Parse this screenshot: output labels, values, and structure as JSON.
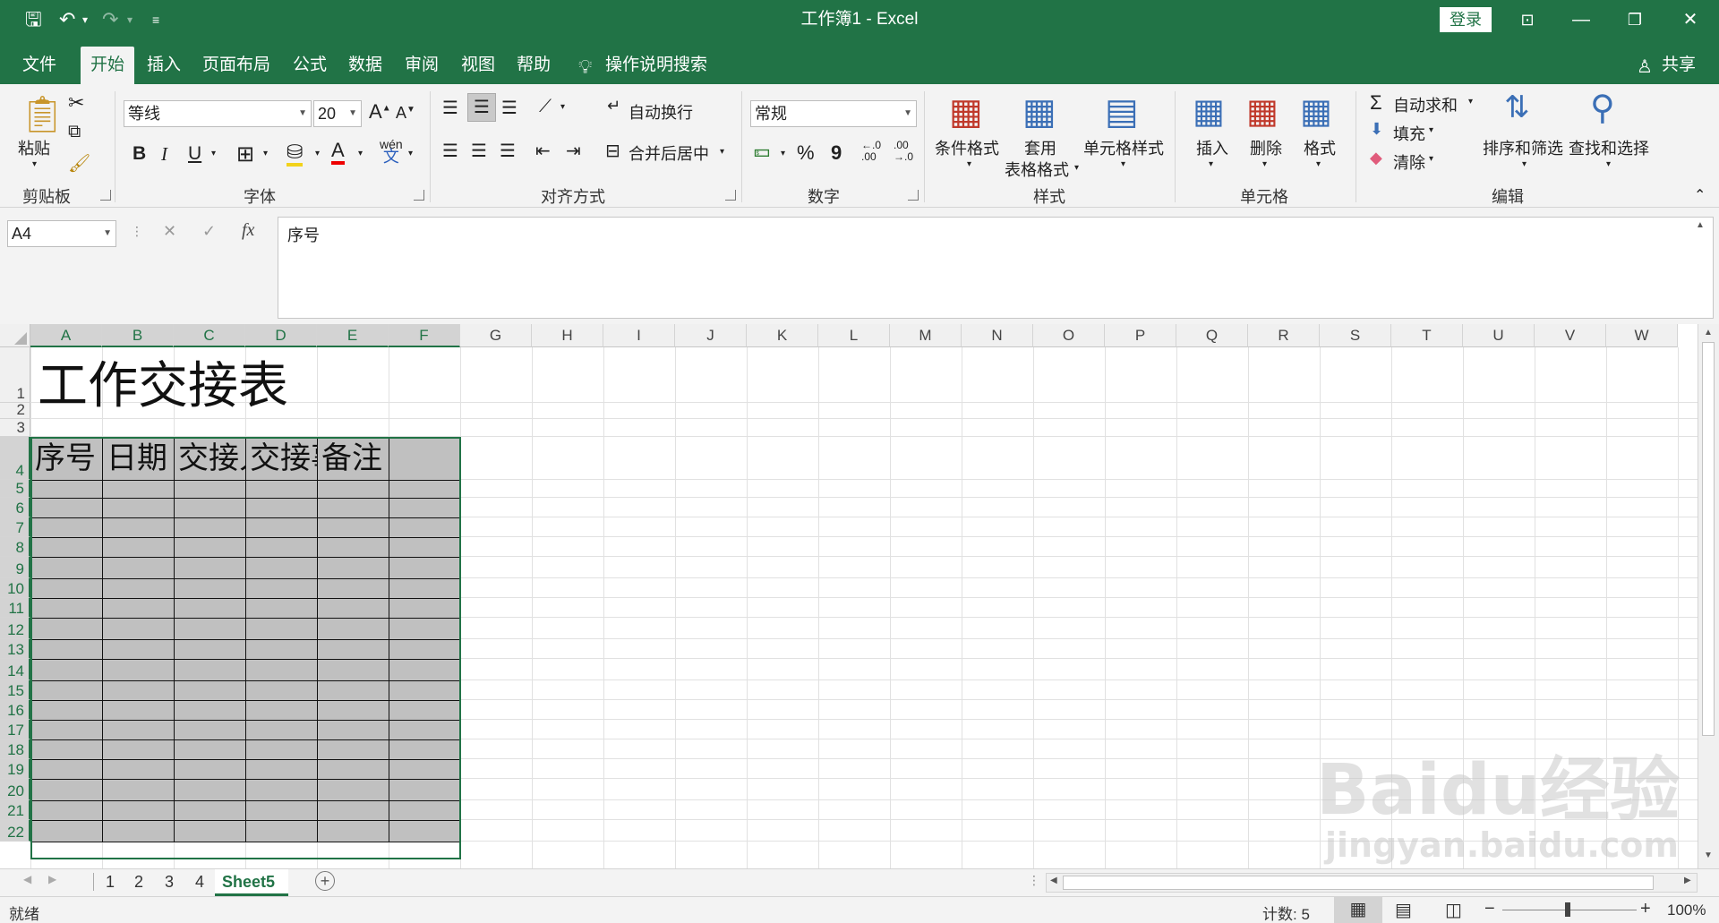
{
  "window": {
    "title": "工作簿1 - Excel",
    "login_label": "登录",
    "share_label": "共享"
  },
  "menu_tabs": [
    "文件",
    "开始",
    "插入",
    "页面布局",
    "公式",
    "数据",
    "审阅",
    "视图",
    "帮助"
  ],
  "tell_me": "操作说明搜索",
  "ribbon": {
    "clipboard": {
      "paste": "粘贴",
      "group": "剪贴板"
    },
    "font": {
      "name": "等线",
      "size": "20",
      "bold": "B",
      "italic": "I",
      "underline": "U",
      "group": "字体"
    },
    "alignment": {
      "wrap": "自动换行",
      "merge": "合并后居中",
      "group": "对齐方式"
    },
    "number": {
      "format": "常规",
      "percent": "%",
      "comma": "9",
      "group": "数字"
    },
    "styles": {
      "conditional": "条件格式",
      "table_line1": "套用",
      "table_line2": "表格格式",
      "cell_styles": "单元格样式",
      "group": "样式"
    },
    "cells": {
      "insert": "插入",
      "delete": "删除",
      "format": "格式",
      "group": "单元格"
    },
    "editing": {
      "autosum": "自动求和",
      "fill": "填充",
      "clear": "清除",
      "sort": "排序和筛选",
      "find": "查找和选择",
      "group": "编辑"
    }
  },
  "formula_bar": {
    "name_box": "A4",
    "fx": "fx",
    "content": "序号"
  },
  "grid": {
    "columns": [
      "A",
      "B",
      "C",
      "D",
      "E",
      "F",
      "G",
      "H",
      "I",
      "J",
      "K",
      "L",
      "M",
      "N",
      "O",
      "P",
      "Q",
      "R",
      "S",
      "T",
      "U",
      "V",
      "W"
    ],
    "rows": [
      "1",
      "2",
      "3",
      "4",
      "5",
      "6",
      "7",
      "8",
      "9",
      "10",
      "11",
      "12",
      "13",
      "14",
      "15",
      "16",
      "17",
      "18",
      "19",
      "20",
      "21",
      "22"
    ],
    "title": "工作交接表",
    "header_cells": [
      "序号",
      "日期",
      "交接人",
      "交接事项",
      "备注",
      ""
    ]
  },
  "sheets": {
    "tabs": [
      "1",
      "2",
      "3",
      "4",
      "Sheet5"
    ],
    "active": "Sheet5"
  },
  "status": {
    "ready": "就绪",
    "count": "计数: 5",
    "zoom": "100%"
  },
  "watermark": {
    "line1": "Baidu经验",
    "line2": "jingyan.baidu.com"
  },
  "colors": {
    "accent": "#217346",
    "selection_fill": "#c0c0c0"
  }
}
